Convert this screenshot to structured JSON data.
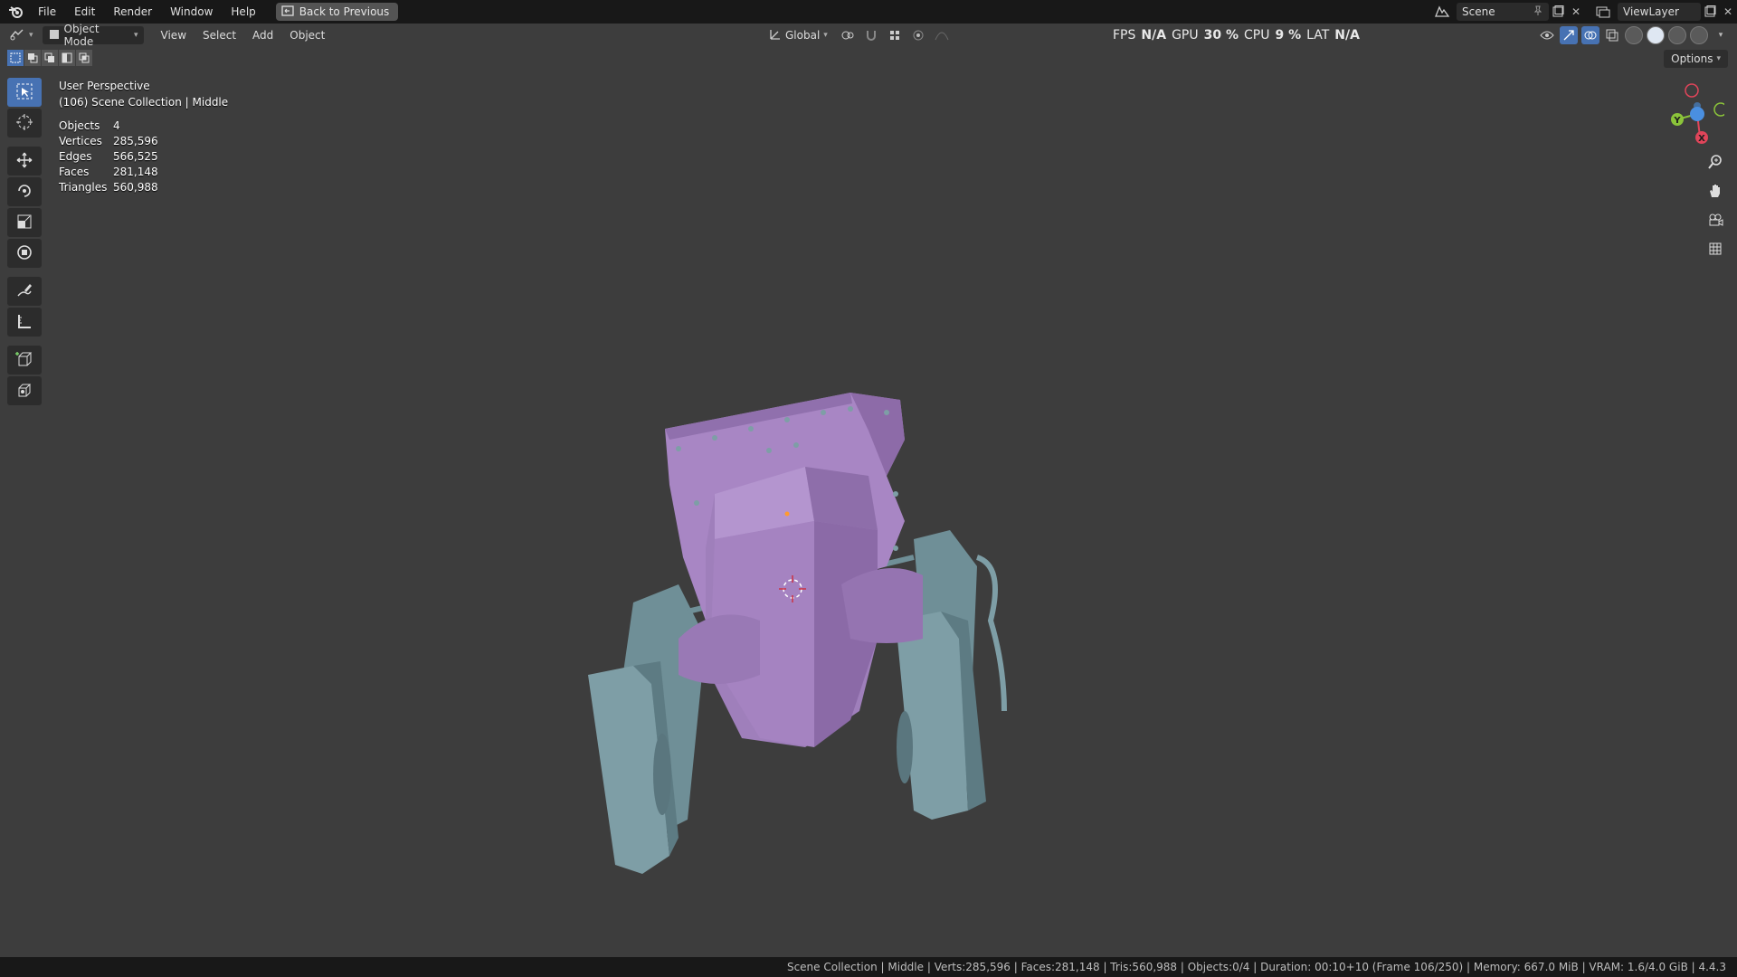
{
  "menubar": {
    "items": [
      "File",
      "Edit",
      "Render",
      "Window",
      "Help"
    ],
    "back_button": "Back to Previous",
    "scene_name": "Scene",
    "view_layer": "ViewLayer"
  },
  "viewport_header": {
    "mode": "Object Mode",
    "menus": [
      "View",
      "Select",
      "Add",
      "Object"
    ],
    "transform_orientation": "Global",
    "options_label": "Options"
  },
  "perf_hud": {
    "fps_label": "FPS",
    "fps_value": "N/A",
    "gpu_label": "GPU",
    "gpu_value": "30 %",
    "cpu_label": "CPU",
    "cpu_value": "9 %",
    "lat_label": "LAT",
    "lat_value": "N/A"
  },
  "overlay": {
    "view_name": "User Perspective",
    "collection_info": "(106) Scene Collection | Middle",
    "stats": [
      {
        "key": "Objects",
        "value": "4"
      },
      {
        "key": "Vertices",
        "value": "285,596"
      },
      {
        "key": "Edges",
        "value": "566,525"
      },
      {
        "key": "Faces",
        "value": "281,148"
      },
      {
        "key": "Triangles",
        "value": "560,988"
      }
    ]
  },
  "gizmo": {
    "y": "Y",
    "x": "X"
  },
  "statusbar": {
    "text": "Scene Collection | Middle | Verts:285,596 | Faces:281,148 | Tris:560,988 | Objects:0/4 | Duration: 00:10+10 (Frame 106/250) | Memory: 667.0 MiB | VRAM: 1.6/4.0 GiB | 4.4.3"
  },
  "colors": {
    "accent": "#4772b3",
    "viewport_bg": "#3d3d3d",
    "model_purple": "#a886c4",
    "model_teal": "#7e9ea6",
    "axis_x": "#e0455a",
    "axis_y": "#8bc43a",
    "axis_z": "#4a8fe0"
  }
}
